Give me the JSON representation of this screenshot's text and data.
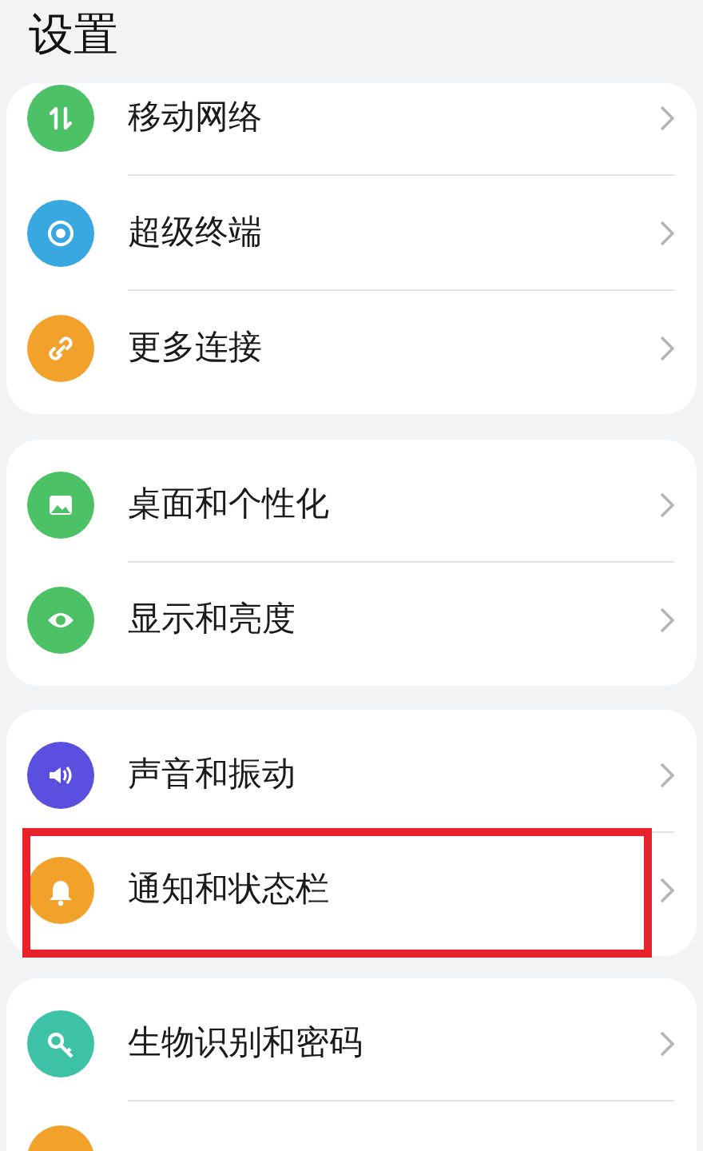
{
  "title": "设置",
  "groups": [
    {
      "items": [
        {
          "label": "移动网络",
          "color": "#4cc166",
          "highlighted": false
        },
        {
          "label": "超级终端",
          "color": "#3aa8e0",
          "highlighted": false
        },
        {
          "label": "更多连接",
          "color": "#f2a22b",
          "highlighted": false
        }
      ]
    },
    {
      "items": [
        {
          "label": "桌面和个性化",
          "color": "#4cc166",
          "highlighted": false
        },
        {
          "label": "显示和亮度",
          "color": "#4cc166",
          "highlighted": false
        }
      ]
    },
    {
      "items": [
        {
          "label": "声音和振动",
          "color": "#5b4fe0",
          "highlighted": false
        },
        {
          "label": "通知和状态栏",
          "color": "#f2a22b",
          "highlighted": true
        }
      ]
    },
    {
      "items": [
        {
          "label": "生物识别和密码",
          "color": "#3dc2a8",
          "highlighted": false
        },
        {
          "color": "#f2a22b",
          "highlighted": false
        }
      ]
    }
  ]
}
